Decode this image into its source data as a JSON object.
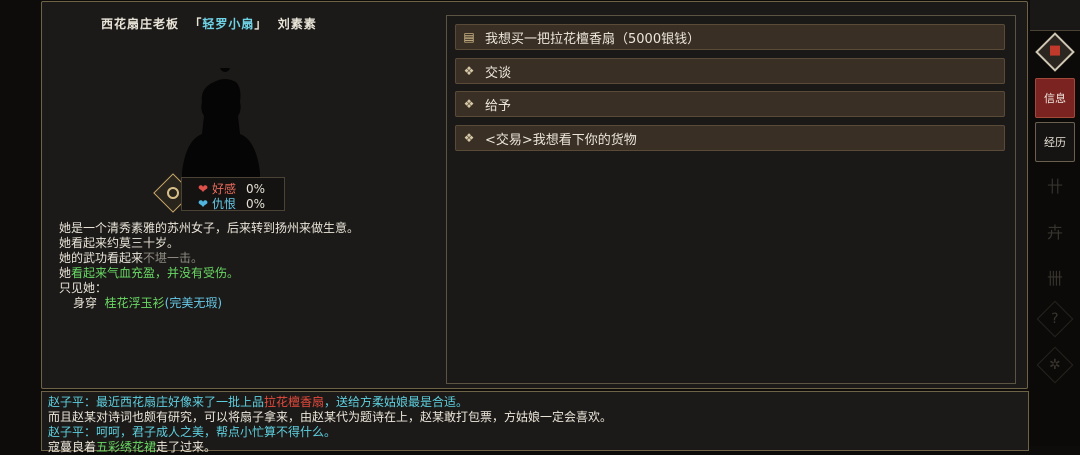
{
  "npc": {
    "title_prefix": "西花扇庄老板",
    "bracket_open": "「",
    "nickname": "轻罗小扇",
    "bracket_close": "」",
    "name": "刘素素"
  },
  "relation": {
    "favor_label": "好感",
    "favor_value": "0%",
    "hatred_label": "仇恨",
    "hatred_value": "0%"
  },
  "description": {
    "line1": "她是一个清秀素雅的苏州女子，后来转到扬州来做生意。",
    "line2": "她看起来约莫三十岁。",
    "line3_prefix": "她的武功看起来",
    "line3_value": "不堪一击。",
    "line4_prefix": "她",
    "line4_value": "看起来气血充盈，并没有受伤。",
    "line5": "只见她：",
    "wear_prefix": "身穿",
    "wear_item": "桂花浮玉衫",
    "wear_quality": "(完美无瑕)"
  },
  "options": [
    {
      "icon": "scroll-icon",
      "label": "我想买一把拉花檀香扇（5000银钱）"
    },
    {
      "icon": "diamond-icon",
      "label": "交谈"
    },
    {
      "icon": "diamond-icon",
      "label": "给予"
    },
    {
      "icon": "diamond-icon",
      "label": "<交易>我想看下你的货物"
    }
  ],
  "side": {
    "tab_info": "信息",
    "tab_history": "经历"
  },
  "dialog": {
    "l1_a": "赵子平：最近西花扇庄好像来了一批上品",
    "l1_b": "拉花檀香扇",
    "l1_c": "，送给方柔姑娘最是合适。",
    "l2": "而且赵某对诗词也颇有研究，可以将扇子拿来，由赵某代为题诗在上，赵某敢打包票，方姑娘一定会喜欢。",
    "l3": "赵子平：呵呵，君子成人之美，帮点小忙算不得什么。",
    "l4_a": "寇蔓良着",
    "l4_b": "五彩绣花裙",
    "l4_c": "走了过来。"
  },
  "colors": {
    "accent_red": "#7a2320",
    "nickname": "#6fd3e6",
    "favor": "#e66a5c",
    "hatred": "#67c9e8",
    "green_text": "#69d964"
  }
}
